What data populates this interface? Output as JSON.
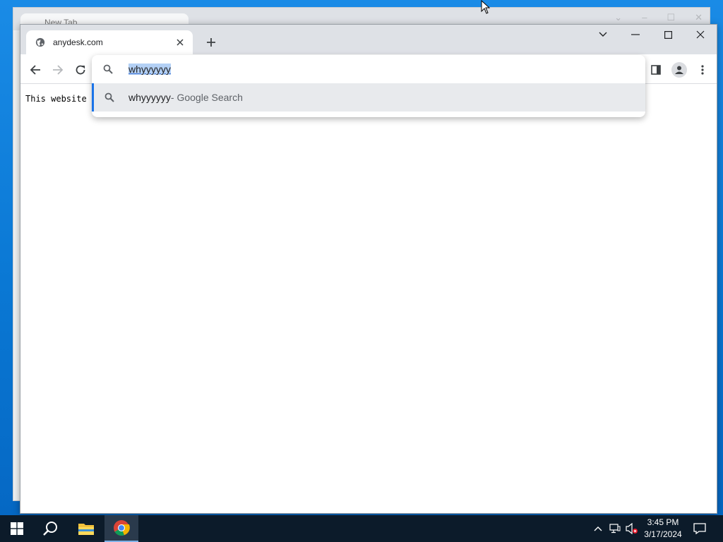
{
  "background_window": {
    "tab_title": "New Tab"
  },
  "browser": {
    "tab": {
      "title": "anydesk.com"
    },
    "new_tab_symbol": "+",
    "page": {
      "text": "This website"
    },
    "omnibox": {
      "input_value": "whyyyyyy",
      "suggestion": {
        "query": "whyyyyyy",
        "suffix": " - Google Search"
      }
    }
  },
  "taskbar": {
    "clock": {
      "time": "3:45 PM",
      "date": "3/17/2024"
    },
    "icons": [
      "windows-start-icon",
      "search-icon",
      "file-explorer-icon",
      "chrome-icon"
    ]
  },
  "colors": {
    "desktop": "#0a78d4",
    "tabstrip": "#dee1e6",
    "selection": "#b3d0f5",
    "suggestion_highlight": "#e8eaed",
    "accent": "#1a73e8",
    "taskbar": "#0c1b2a"
  }
}
